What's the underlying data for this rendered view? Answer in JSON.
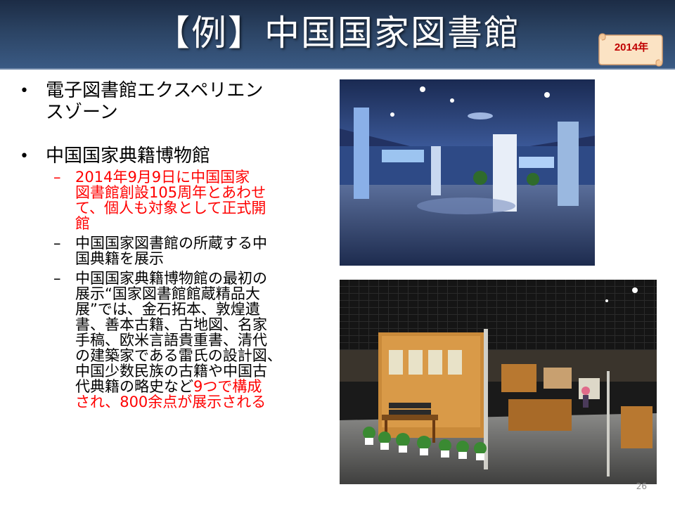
{
  "slide": {
    "title": "【例】中国国家図書館",
    "badge": "2014年",
    "page_number": "26"
  },
  "bullets": [
    {
      "text": "電子図書館エクスペリエンスゾーン",
      "line1": "電子図書館エクスペリエン",
      "line2": "スゾーン"
    },
    {
      "text": "中国国家典籍博物館"
    }
  ],
  "sub_items": [
    {
      "lines": [
        "2014年9月9日に中国国家",
        "図書館創設105周年とあわせ",
        "て、個人も対象として正式開",
        "館"
      ],
      "color": "#ff0000"
    },
    {
      "lines": [
        "中国国家図書館の所蔵する中",
        "国典籍を展示"
      ]
    },
    {
      "lines": [
        "中国国家典籍博物館の最初の",
        "展示“国家図書館館蔵精品大",
        "展”では、金石拓本、敦煌遺",
        "書、善本古籍、古地図、名家",
        "手稿、欧米言語貴重書、清代",
        "の建築家である雷氏の設計図、",
        "中国少数民族の古籍や中国古"
      ],
      "line8_black": "代典籍の略史など",
      "line8_red": "9つで構成",
      "line9_red": "され、800余点が展示される"
    }
  ],
  "colors": {
    "title_bg": "#2b4363",
    "emphasis": "#ff0000",
    "badge_bg": "#fbe3c4"
  },
  "images": [
    {
      "icon": "library-experience-zone-photo"
    },
    {
      "icon": "classics-museum-exhibition-photo"
    }
  ]
}
